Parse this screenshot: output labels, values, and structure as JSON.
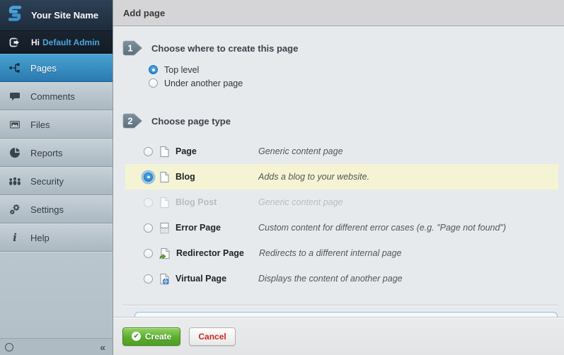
{
  "sidebar": {
    "site_name": "Your Site Name",
    "greeting": "Hi",
    "user_name": "Default Admin",
    "items": [
      {
        "label": "Pages",
        "icon": "sitemap-icon",
        "active": true
      },
      {
        "label": "Comments",
        "icon": "comment-icon",
        "active": false
      },
      {
        "label": "Files",
        "icon": "image-icon",
        "active": false
      },
      {
        "label": "Reports",
        "icon": "piechart-icon",
        "active": false
      },
      {
        "label": "Security",
        "icon": "people-icon",
        "active": false
      },
      {
        "label": "Settings",
        "icon": "gears-icon",
        "active": false
      },
      {
        "label": "Help",
        "icon": "info-icon",
        "active": false
      }
    ],
    "collapse_label": "«"
  },
  "header": {
    "title": "Add page"
  },
  "steps": [
    {
      "number": "1",
      "title": "Choose where to create this page"
    },
    {
      "number": "2",
      "title": "Choose page type"
    }
  ],
  "location_options": [
    {
      "label": "Top level",
      "selected": true
    },
    {
      "label": "Under another page",
      "selected": false
    }
  ],
  "page_types": [
    {
      "label": "Page",
      "description": "Generic content page",
      "icon": "page-icon",
      "selected": false,
      "disabled": false,
      "highlighted": false
    },
    {
      "label": "Blog",
      "description": "Adds a blog to your website.",
      "icon": "page-icon",
      "selected": true,
      "disabled": false,
      "highlighted": true
    },
    {
      "label": "Blog Post",
      "description": "Generic content page",
      "icon": "page-icon",
      "selected": false,
      "disabled": true,
      "highlighted": false
    },
    {
      "label": "Error Page",
      "description": "Custom content for different error cases (e.g. \"Page not found\")",
      "icon": "error-page-icon",
      "selected": false,
      "disabled": false,
      "highlighted": false
    },
    {
      "label": "Redirector Page",
      "description": "Redirects to a different internal page",
      "icon": "redirect-page-icon",
      "selected": false,
      "disabled": false,
      "highlighted": false
    },
    {
      "label": "Virtual Page",
      "description": "Displays the content of another page",
      "icon": "virtual-page-icon",
      "selected": false,
      "disabled": false,
      "highlighted": false
    }
  ],
  "footer": {
    "create_label": "Create",
    "cancel_label": "Cancel",
    "check_glyph": "✔"
  },
  "colors": {
    "sidebar_active_blue": "#3390c8",
    "link_blue": "#4ba6de",
    "highlight_yellow": "#f4f4d5",
    "create_green": "#57a829",
    "cancel_red": "#cf2620",
    "step_badge_gray": "#667987"
  }
}
